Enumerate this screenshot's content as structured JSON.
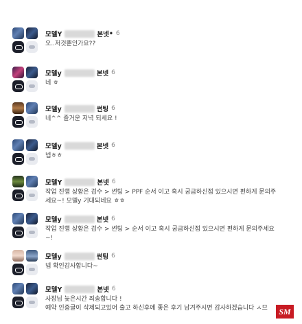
{
  "comments": [
    {
      "author": "모델Y",
      "shop": "본넷",
      "badge": "•",
      "count": "6",
      "text": "오..저것뿐인가요??"
    },
    {
      "author": "모델y",
      "shop": "본넷",
      "badge": "",
      "count": "6",
      "text": "네 ㅎ"
    },
    {
      "author": "모델y",
      "shop": "썬팅",
      "badge": "",
      "count": "6",
      "text": "네^^ 즐거운 저녁 되세요 !"
    },
    {
      "author": "모델y",
      "shop": "본넷",
      "badge": "",
      "count": "6",
      "text": "넵ㅎㅎ"
    },
    {
      "author": "모델Y",
      "shop": "본넷",
      "badge": "",
      "count": "6",
      "text": "작업 진행 상황은 검수 > 썬팅 > PPF 순서 이고 혹시 궁금하신점 있으시면 편하게 문의주\n세요~! 모델y 기대되네요 ㅎㅎ"
    },
    {
      "author": "모델y",
      "shop": "본넷",
      "badge": "",
      "count": "6",
      "text": "작업 진행 상황은 검수 > 썬팅 > 순서 이고 혹시 궁금하신점 있으시면 편하게 문의주세요\n~!"
    },
    {
      "author": "모델y",
      "shop": "썬팅",
      "badge": "",
      "count": "6",
      "text": "넵 확인감사합니다~"
    },
    {
      "author": "모델Y",
      "shop": "본넷",
      "badge": "",
      "count": "6",
      "text": "사장님 늦은시간 죄송합니다 !\n예약 인증글이 삭제되고있어 출고 하신후에 좋은 후기 남겨주시면 감사하겠습니다 ㅅ므"
    }
  ],
  "watermark": "SM"
}
